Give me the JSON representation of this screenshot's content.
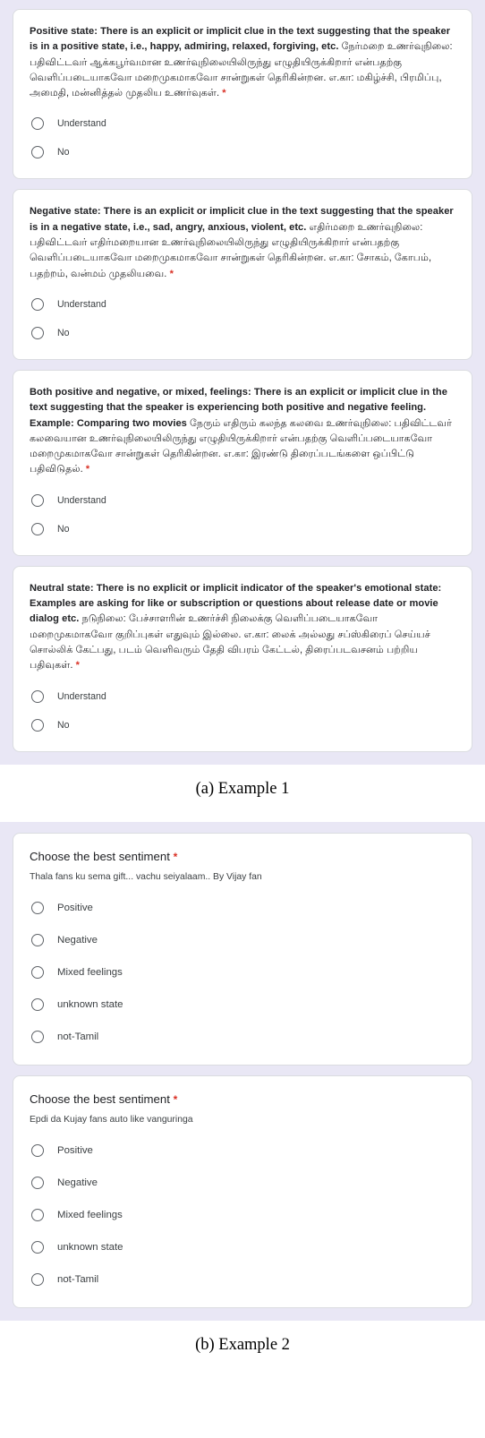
{
  "page": {
    "background": "#ffffff",
    "panel_background": "#E9E7F5",
    "card_background": "#ffffff",
    "required_marker_color": "#d93025",
    "required_marker": "*"
  },
  "figures": [
    {
      "caption": "(a) Example 1",
      "cards": [
        {
          "prompt_en": "Positive state: There is an explicit or implicit clue in the text suggesting that the speaker is in a positive state, i.e., happy, admiring, relaxed, forgiving, etc.",
          "prompt_ta": "நேர்மறை உணர்வுநிலை: பதிவிட்டவர் ஆக்கபூர்வமான உணர்வுநிலையிலிருந்து எழுதியிருக்கிறார் என்பதற்கு வெளிப்படையாகவோ மறைமுகமாகவோ சான்றுகள் தெரிகின்றன. எ.கா: மகிழ்ச்சி, பிரமிப்பு, அமைதி, மன்னித்தல் முதலிய உணர்வுகள்.",
          "options": [
            "Understand",
            "No"
          ]
        },
        {
          "prompt_en": "Negative state: There is an explicit or implicit clue in the text suggesting that the speaker is in a negative state, i.e., sad, angry, anxious, violent, etc.",
          "prompt_ta": "எதிர்மறை உணர்வுநிலை: பதிவிட்டவர் எதிர்மறையான உணர்வுநிலையிலிருந்து எழுதியிருக்கிறார் என்பதற்கு வெளிப்படையாகவோ மறைமுகமாகவோ சான்றுகள் தெரிகின்றன. எ.கா: சோகம், கோபம், பதற்றம், வன்மம் முதலியவை.",
          "options": [
            "Understand",
            "No"
          ]
        },
        {
          "prompt_en": "Both positive and negative, or mixed, feelings: There is an explicit or implicit clue in the text suggesting that the speaker is experiencing both positive and negative feeling. Example: Comparing two movies",
          "prompt_ta": "நேரும் எதிரும் கலந்த கலவை உணர்வுநிலை: பதிவிட்டவர் கலவையான உணர்வுநிலையிலிருந்து எழுதியிருக்கிறார் என்பதற்கு வெளிப்படையாகவோ மறைமுகமாகவோ சான்றுகள் தெரிகின்றன. எ.கா: இரண்டு திரைப்படங்களை ஒப்பிட்டு பதிவிடுதல்.",
          "options": [
            "Understand",
            "No"
          ]
        },
        {
          "prompt_en": "Neutral state: There is no explicit or implicit indicator of the speaker's emotional state: Examples are asking for like or subscription or questions about release date or movie dialog etc.",
          "prompt_ta": "நடுநிலை: பேச்சாளரின் உணர்ச்சி நிலைக்கு வெளிப்படையாகவோ மறைமுகமாகவோ குறிப்புகள் எதுவும் இல்லை. எ.கா: லைக் அல்லது சப்ஸ்கிரைப் செய்யச் சொல்லிக் கேட்பது, படம் வெளிவரும் தேதி விபரம் கேட்டல், திரைப்படவசனம் பற்றிய பதிவுகள்.",
          "options": [
            "Understand",
            "No"
          ]
        }
      ]
    },
    {
      "caption": "(b) Example 2",
      "cards": [
        {
          "title": "Choose the best sentiment",
          "subtitle": "Thala fans ku sema gift... vachu seiyalaam.. By Vijay fan",
          "options": [
            "Positive",
            "Negative",
            "Mixed feelings",
            "unknown state",
            "not-Tamil"
          ]
        },
        {
          "title": "Choose the best sentiment",
          "subtitle": "Epdi da Kujay fans auto like vanguringa",
          "options": [
            "Positive",
            "Negative",
            "Mixed feelings",
            "unknown state",
            "not-Tamil"
          ]
        }
      ]
    }
  ]
}
